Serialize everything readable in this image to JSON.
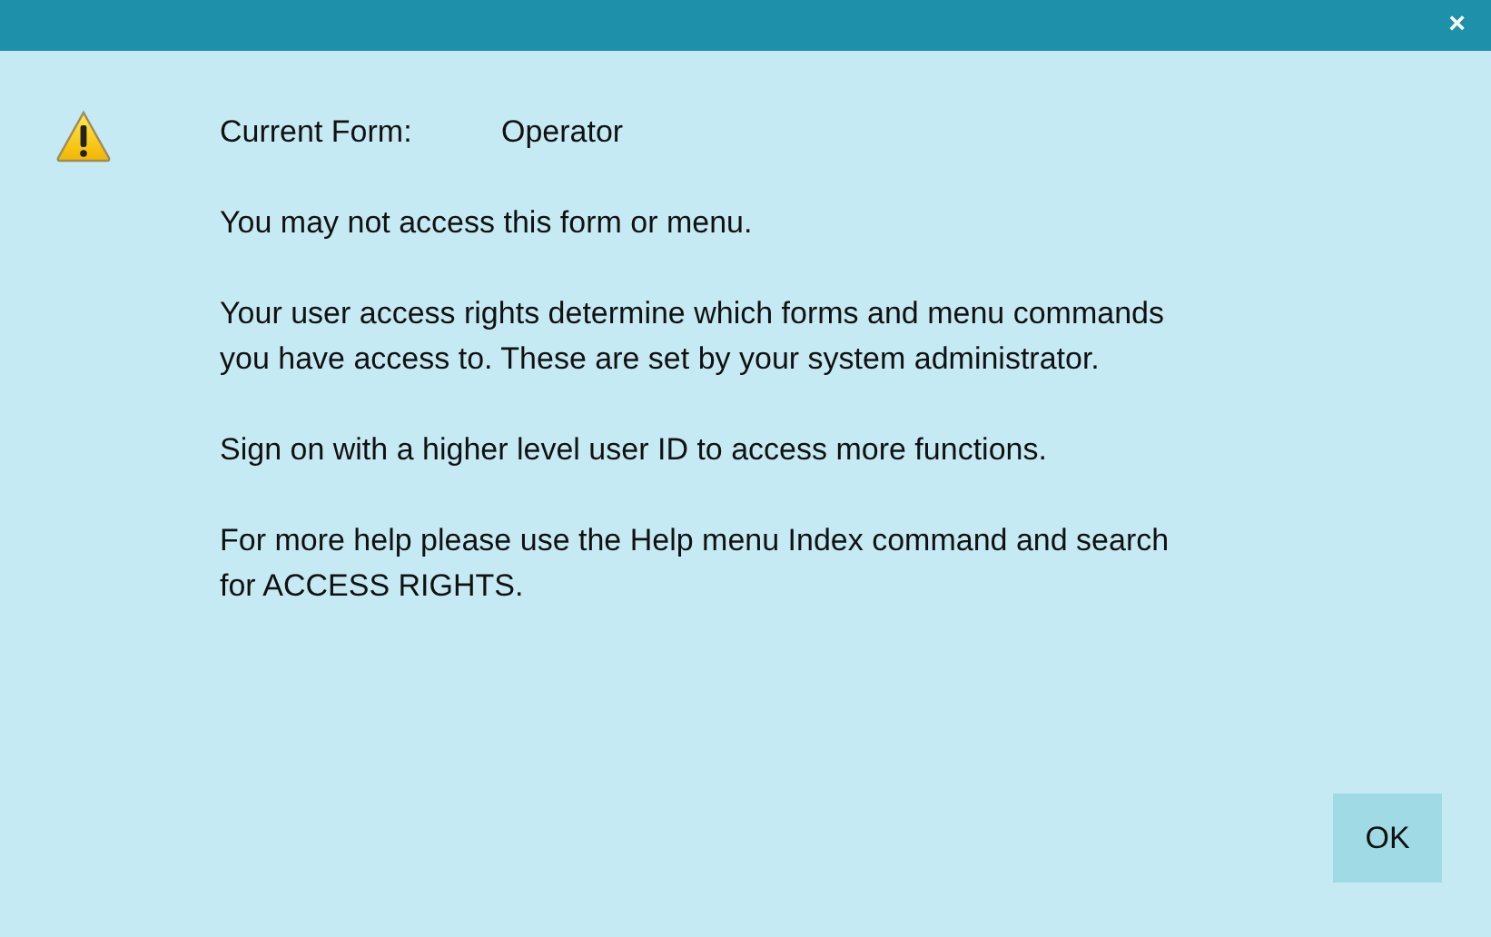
{
  "window": {
    "close_glyph": "×"
  },
  "header": {
    "label": "Current Form:",
    "value": "Operator"
  },
  "paragraphs": [
    {
      "lines": [
        "You may not access this form or menu."
      ]
    },
    {
      "lines": [
        "Your user access rights determine which forms and menu commands",
        "you have access to. These are set by your system administrator."
      ]
    },
    {
      "lines": [
        "Sign on with a higher level user ID to access more functions."
      ]
    },
    {
      "lines": [
        "For more help please use the Help menu Index command and search",
        "for ACCESS RIGHTS."
      ]
    }
  ],
  "buttons": [
    "OK"
  ]
}
